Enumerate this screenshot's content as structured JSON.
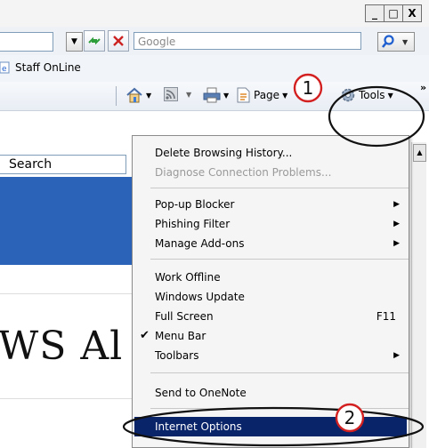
{
  "window": {
    "minimize": "_",
    "maximize": "□",
    "close": "X"
  },
  "search": {
    "placeholder": "Google"
  },
  "favorites": {
    "link_label": "Staff OnLine"
  },
  "command_bar": {
    "page_label": "Page",
    "tools_label": "Tools"
  },
  "page": {
    "search_label": "Search",
    "heading_fragment": "WS Al"
  },
  "menu": {
    "items": [
      {
        "label": "Delete Browsing History...",
        "enabled": true
      },
      {
        "label": "Diagnose Connection Problems...",
        "enabled": false
      },
      {
        "label": "Pop-up Blocker",
        "submenu": true
      },
      {
        "label": "Phishing Filter",
        "submenu": true
      },
      {
        "label": "Manage Add-ons",
        "submenu": true
      },
      {
        "label": "Work Offline"
      },
      {
        "label": "Windows Update"
      },
      {
        "label": "Full Screen",
        "shortcut": "F11"
      },
      {
        "label": "Menu Bar",
        "checked": true
      },
      {
        "label": "Toolbars",
        "submenu": true
      },
      {
        "label": "Send to OneNote"
      },
      {
        "label": "Internet Options",
        "highlighted": true
      }
    ]
  },
  "annotations": {
    "step1": "1",
    "step2": "2"
  },
  "colors": {
    "highlight": "#0a246a",
    "banner": "#2a63b8",
    "stop": "#cc2222",
    "refresh": "#2e9e3a",
    "search_icon": "#1f5fcf"
  }
}
